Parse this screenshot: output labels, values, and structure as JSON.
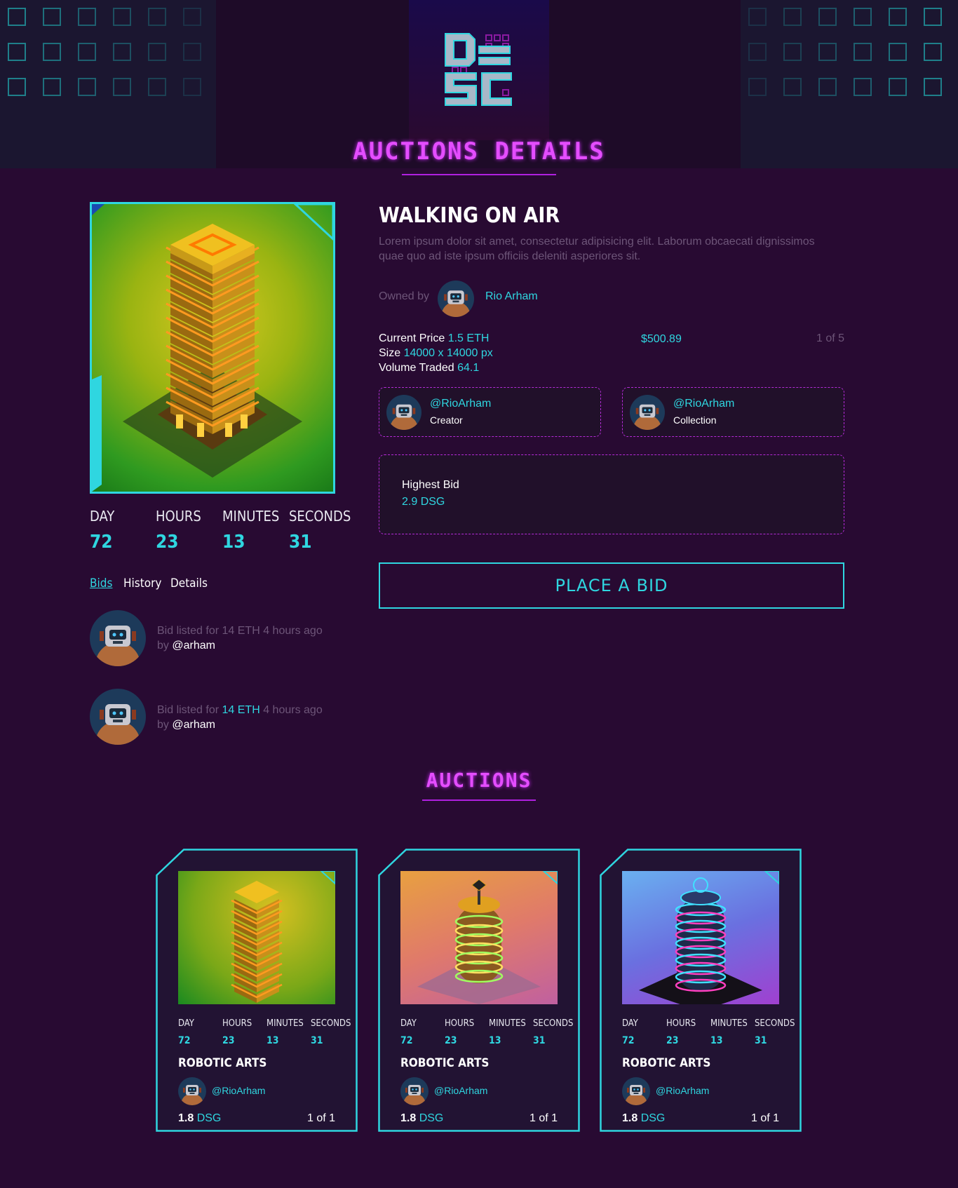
{
  "header": {
    "title": "AUCTIONS DETAILS"
  },
  "item": {
    "title": "WALKING ON AIR",
    "description": "Lorem ipsum dolor sit amet, consectetur adipisicing elit. Laborum obcaecati dignissimos quae quo ad iste ipsum officiis deleniti asperiores sit.",
    "owned_label": "Owned by",
    "owner": "Rio Arham",
    "price_label": "Current Price",
    "price_value": "1.5 ETH",
    "size_label": "Size",
    "size_value": "14000 x 14000 px",
    "volume_label": "Volume Traded",
    "volume_value": "64.1",
    "usd": "$500.89",
    "edition": "1 of 5"
  },
  "countdown": {
    "day_label": "DAY",
    "hours_label": "HOURS",
    "minutes_label": "MINUTES",
    "seconds_label": "SECONDS",
    "day": "72",
    "hours": "23",
    "minutes": "13",
    "seconds": "31"
  },
  "tabs": [
    "Bids",
    "History",
    "Details"
  ],
  "bids": [
    {
      "prefix": "Bid listed for",
      "amount": "14 ETH",
      "time": "4 hours ago",
      "by": "by",
      "user": "@arham"
    },
    {
      "prefix": "Bid listed for",
      "amount": "14 ETH",
      "time": "4 hours ago",
      "by": "by",
      "user": "@arham"
    }
  ],
  "creator": {
    "handle": "@RioArham",
    "role": "Creator"
  },
  "collection": {
    "handle": "@RioArham",
    "role": "Collection"
  },
  "highest_bid": {
    "label": "Highest Bid",
    "value": "2.9 DSG"
  },
  "place_bid_label": "PLACE A BID",
  "auctions": {
    "title": "AUCTIONS",
    "cards": [
      {
        "title": "ROBOTIC ARTS",
        "handle": "@RioArham",
        "price": "1.8",
        "currency": "DSG",
        "edition": "1 of 1",
        "day": "72",
        "hours": "23",
        "minutes": "13",
        "seconds": "31"
      },
      {
        "title": "ROBOTIC ARTS",
        "handle": "@RioArham",
        "price": "1.8",
        "currency": "DSG",
        "edition": "1 of 1",
        "day": "72",
        "hours": "23",
        "minutes": "13",
        "seconds": "31"
      },
      {
        "title": "ROBOTIC ARTS",
        "handle": "@RioArham",
        "price": "1.8",
        "currency": "DSG",
        "edition": "1 of 1",
        "day": "72",
        "hours": "23",
        "minutes": "13",
        "seconds": "31"
      }
    ]
  },
  "colors": {
    "accent": "#2fd6e0",
    "neon": "#e44dff",
    "background": "#280a32"
  }
}
